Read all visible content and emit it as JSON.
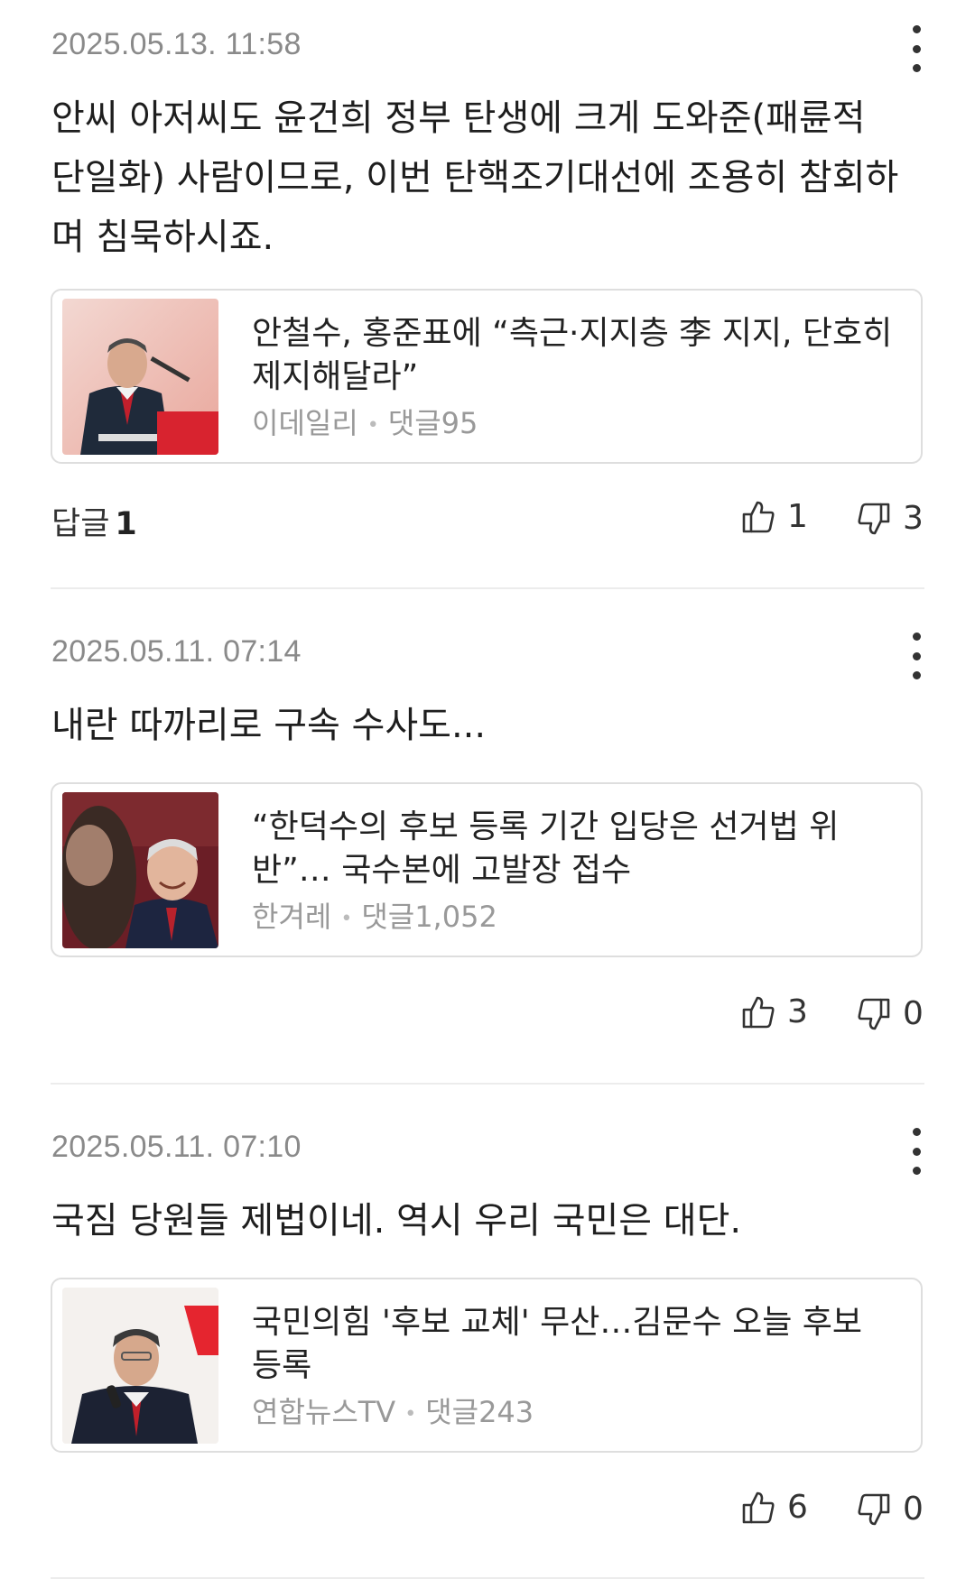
{
  "comments": [
    {
      "date": "2025.05.13. 11:58",
      "text": "안씨 아저씨도 윤건희 정부 탄생에 크게 도와준(패륜적 단일화) 사람이므로, 이번 탄핵조기대선에 조용히 참회하며 침묵하시죠.",
      "article": {
        "title": "안철수, 홍준표에 “측근·지지층 李 지지, 단호히 제지해달라”",
        "source": "이데일리",
        "comments": "댓글95"
      },
      "replies_label": "답글",
      "replies_count": "1",
      "likes": "1",
      "dislikes": "3"
    },
    {
      "date": "2025.05.11. 07:14",
      "text": "내란 따까리로 구속 수사도...",
      "article": {
        "title": "“한덕수의 후보 등록 기간 입당은 선거법 위반”… 국수본에 고발장 접수",
        "source": "한겨레",
        "comments": "댓글1,052"
      },
      "likes": "3",
      "dislikes": "0"
    },
    {
      "date": "2025.05.11. 07:10",
      "text": "국짐 당원들 제법이네. 역시 우리 국민은 대단.",
      "article": {
        "title": "국민의힘 '후보 교체' 무산…김문수 오늘 후보 등록",
        "source": "연합뉴스TV",
        "comments": "댓글243"
      },
      "likes": "6",
      "dislikes": "0"
    }
  ],
  "icons": {
    "more": "more-vertical-icon",
    "like": "thumbs-up-icon",
    "dislike": "thumbs-down-icon"
  },
  "colors": {
    "meta_gray": "#8a8a8a",
    "divider": "#ececec",
    "card_border": "#dedede"
  }
}
